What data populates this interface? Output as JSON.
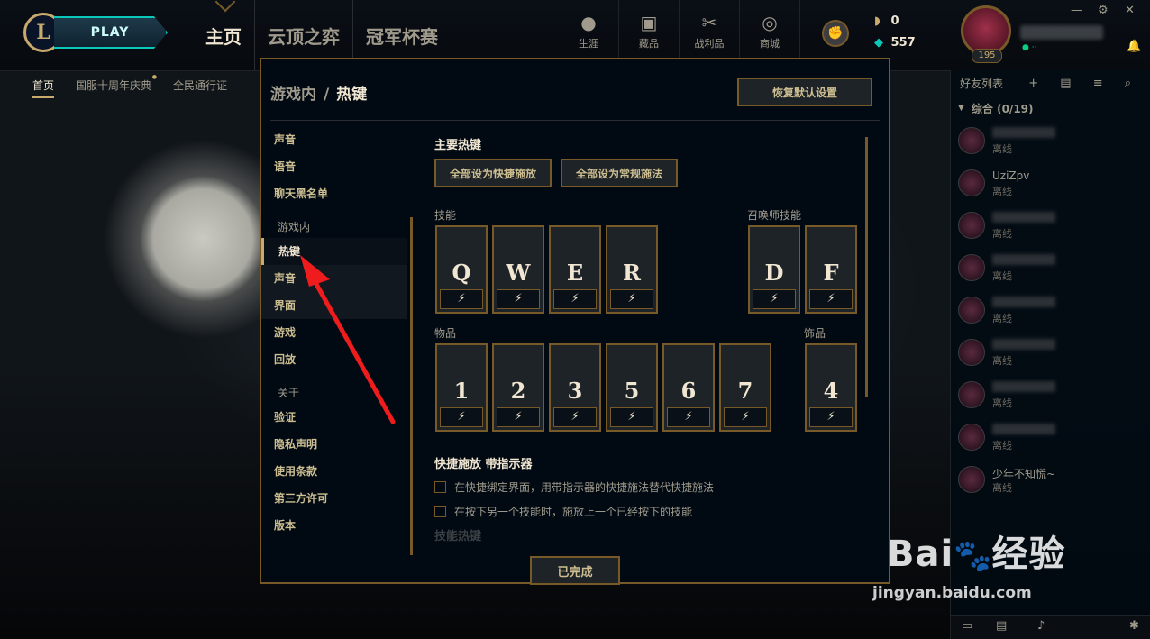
{
  "topbar": {
    "logo_letter": "L",
    "play_label": "PLAY",
    "tabs": [
      {
        "label": "主页",
        "active": true
      },
      {
        "label": "云顶之弈",
        "active": false
      },
      {
        "label": "冠军杯赛",
        "active": false
      }
    ],
    "nav": [
      {
        "label": "生涯",
        "icon": "profile-icon"
      },
      {
        "label": "藏品",
        "icon": "collection-icon"
      },
      {
        "label": "战利品",
        "icon": "loot-icon"
      },
      {
        "label": "商城",
        "icon": "store-icon"
      }
    ],
    "currency": {
      "rp": "0",
      "be": "557"
    },
    "level": "195",
    "window_controls": {
      "minimize": "—",
      "settings": "⚙",
      "close": "✕"
    }
  },
  "subnav": [
    {
      "label": "首页",
      "active": true
    },
    {
      "label": "国服十周年庆典",
      "dot": true
    },
    {
      "label": "全民通行证"
    }
  ],
  "friends": {
    "header": "好友列表",
    "group": "综合 (0/19)",
    "items": [
      {
        "name": "",
        "status": "离线"
      },
      {
        "name": "UziZpv",
        "status": "离线"
      },
      {
        "name": "",
        "status": "离线"
      },
      {
        "name": "",
        "status": "离线"
      },
      {
        "name": "",
        "status": "离线"
      },
      {
        "name": "",
        "status": "离线"
      },
      {
        "name": "",
        "status": "离线"
      },
      {
        "name": "",
        "status": "离线"
      },
      {
        "name": "少年不知慌~",
        "status": "离线"
      },
      {
        "name": "",
        "status": ""
      }
    ]
  },
  "modal": {
    "breadcrumb_parent": "游戏内",
    "breadcrumb_sep": "/",
    "breadcrumb_current": "热键",
    "restore_label": "恢复默认设置",
    "nav": {
      "top": [
        "声音",
        "语音",
        "聊天黑名单"
      ],
      "section_ingame": "游戏内",
      "ingame": [
        "热键",
        "声音",
        "界面",
        "游戏",
        "回放"
      ],
      "section_about": "关于",
      "about": [
        "验证",
        "隐私声明",
        "使用条款",
        "第三方许可",
        "版本"
      ]
    },
    "content": {
      "title": "主要热键",
      "quick_all_label": "全部设为快捷施放",
      "normal_all_label": "全部设为常规施法",
      "abilities_label": "技能",
      "summoner_label": "召唤师技能",
      "items_label": "物品",
      "trinket_label": "饰品",
      "abilities": [
        "Q",
        "W",
        "E",
        "R"
      ],
      "summoners": [
        "D",
        "F"
      ],
      "items": [
        "1",
        "2",
        "3",
        "5",
        "6",
        "7"
      ],
      "trinket": [
        "4"
      ],
      "mode_icon": "⚡",
      "quickcast_title": "快捷施放 带指示器",
      "options": [
        {
          "label": "在快捷绑定界面，用带指示器的快捷施法替代快捷施法",
          "checked": false
        },
        {
          "label": "在按下另一个技能时，施放上一个已经按下的技能",
          "checked": false
        }
      ],
      "faded_next": "技能热键"
    },
    "done_label": "已完成"
  },
  "watermark": {
    "brand": "Bai",
    "brand2": "经验",
    "url": "jingyan.baidu.com"
  }
}
